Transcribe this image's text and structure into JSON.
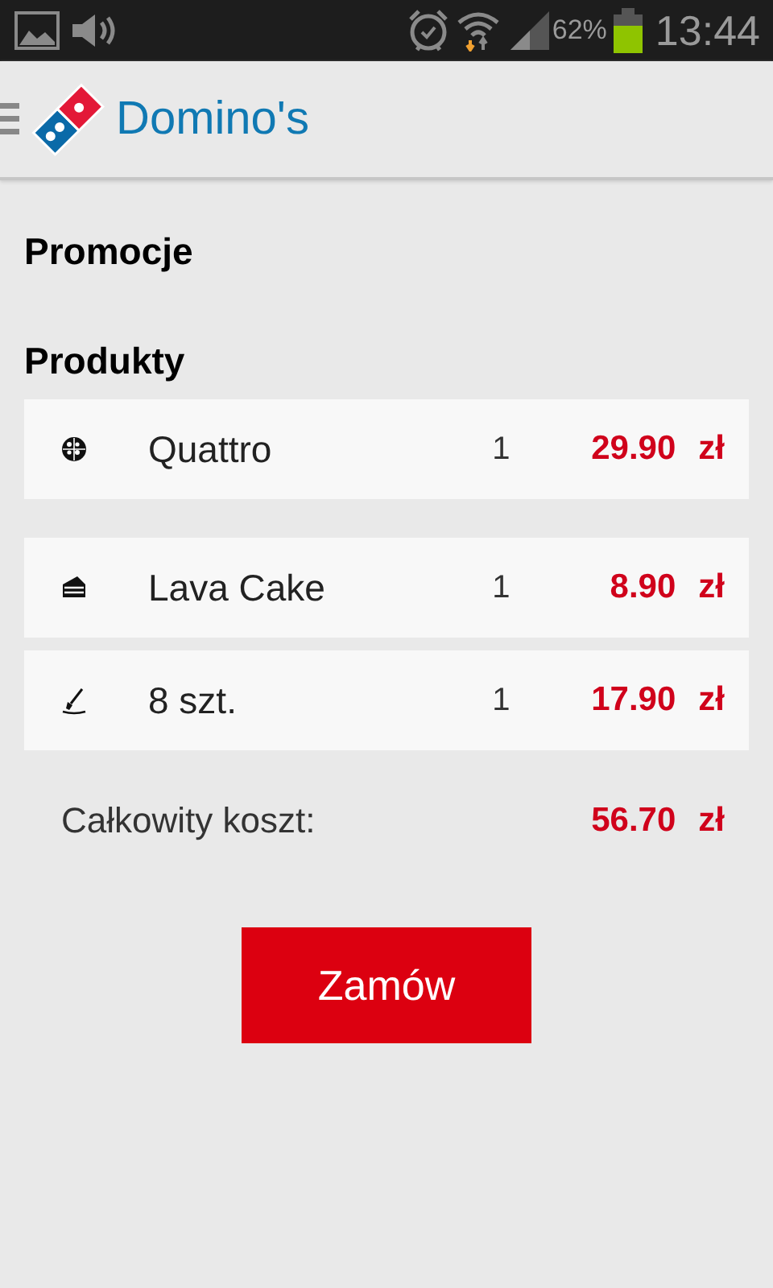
{
  "status_bar": {
    "battery_text": "62%",
    "time": "13:44"
  },
  "app_bar": {
    "title": "Domino's"
  },
  "sections": [
    {
      "title": "Promocje"
    },
    {
      "title": "Produkty"
    }
  ],
  "items": [
    {
      "kind": "pizza",
      "name": "Quattro",
      "quantity": "1",
      "price": "29.90",
      "currency": "zł"
    },
    {
      "kind": "cake",
      "name": "Lava Cake",
      "quantity": "1",
      "price": "8.90",
      "currency": "zł"
    },
    {
      "kind": "sticks",
      "name": "8 szt.",
      "quantity": "1",
      "price": "17.90",
      "currency": "zł"
    }
  ],
  "total": {
    "label": "Całkowity koszt:",
    "price": "56.70",
    "currency": "zł"
  },
  "order_button": "Zamów"
}
